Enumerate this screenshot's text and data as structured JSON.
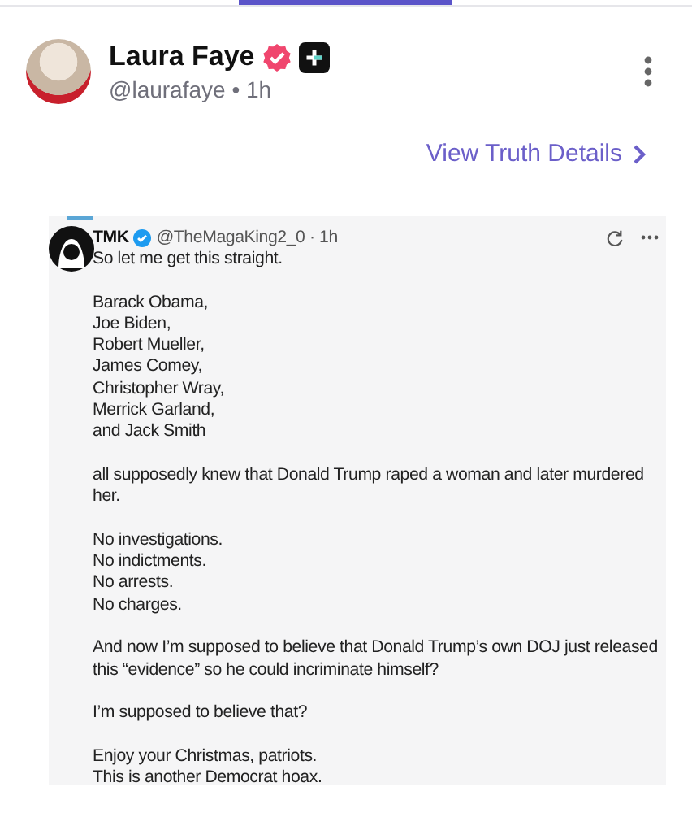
{
  "post": {
    "author_name": "Laura Faye",
    "handle_line": "@laurafaye • 1h",
    "details_link": "View Truth Details"
  },
  "quoted_image": {
    "author_name": "TMK",
    "handle_line": "@TheMagaKing2_0 · 1h",
    "paragraphs": [
      [
        "So let me get this straight."
      ],
      [
        "Barack Obama,",
        "Joe Biden,",
        "Robert Mueller,",
        "James Comey,",
        "Christopher Wray,",
        "Merrick Garland,",
        "and Jack Smith"
      ],
      [
        "all supposedly knew that Donald Trump raped a woman and later murdered her."
      ],
      [
        "No investigations.",
        "No indictments.",
        "No arrests.",
        "No charges."
      ],
      [
        "And now I’m supposed to believe that Donald Trump’s own DOJ just released this “evidence” so he could incriminate himself?"
      ],
      [
        "I’m supposed to believe that?"
      ],
      [
        "Enjoy your Christmas, patriots.",
        "This is another Democrat hoax."
      ]
    ]
  }
}
